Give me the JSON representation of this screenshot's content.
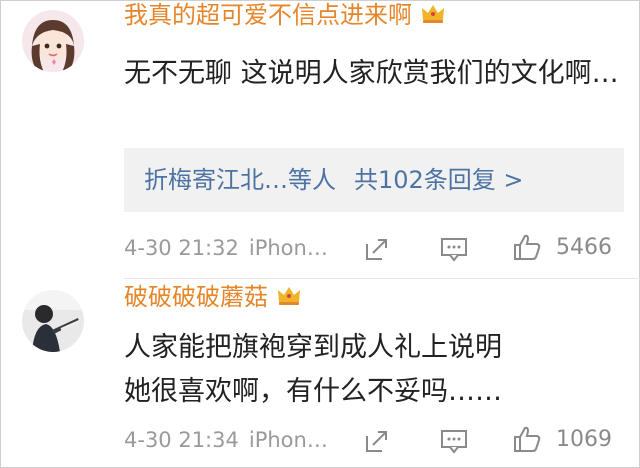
{
  "comments": [
    {
      "username": "我真的超可爱不信点进来啊",
      "text": "无不无聊 这说明人家欣赏我们的文化啊…",
      "reply_summary": {
        "users": "折梅寄江北…等人",
        "count": "共102条回复 >"
      },
      "time": "4-30 21:32",
      "source": "iPhon…",
      "likes": "5466"
    },
    {
      "username": "破破破破蘑菇",
      "text": "人家能把旗袍穿到成人礼上说明她很喜欢啊，有什么不妥吗……",
      "time": "4-30 21:34",
      "source": "iPhon…",
      "likes": "1069"
    }
  ],
  "colors": {
    "username": "#e5862b",
    "reply_link": "#4d73a3",
    "meta": "#9a9a9a",
    "crown": "#f0b429"
  },
  "icons": [
    "crown-icon",
    "share-icon",
    "reply-icon",
    "like-icon"
  ]
}
